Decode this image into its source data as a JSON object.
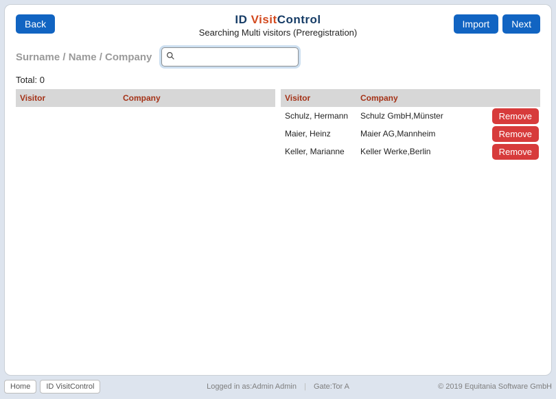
{
  "topbar": {
    "back_label": "Back",
    "import_label": "Import",
    "next_label": "Next"
  },
  "brand": {
    "id": "ID",
    "visit": "Visit",
    "control": "Control",
    "subtitle": "Searching Multi visitors (Preregistration)"
  },
  "search": {
    "label": "Surname / Name / Company",
    "value": "",
    "placeholder": ""
  },
  "total": {
    "label": "Total:",
    "value": "0"
  },
  "left_table": {
    "headers": {
      "visitor": "Visitor",
      "company": "Company"
    },
    "rows": []
  },
  "right_table": {
    "headers": {
      "visitor": "Visitor",
      "company": "Company"
    },
    "remove_label": "Remove",
    "rows": [
      {
        "visitor": "Schulz, Hermann",
        "company": "Schulz GmbH,Münster"
      },
      {
        "visitor": "Maier, Heinz",
        "company": "Maier AG,Mannheim"
      },
      {
        "visitor": "Keller, Marianne",
        "company": "Keller Werke,Berlin"
      }
    ]
  },
  "footer": {
    "crumbs": [
      "Home",
      "ID VisitControl"
    ],
    "logged_in_label": "Logged in as:",
    "user": "Admin Admin",
    "gate_label": "Gate:",
    "gate": "Tor A",
    "copyright": "© 2019 Equitania Software GmbH"
  }
}
